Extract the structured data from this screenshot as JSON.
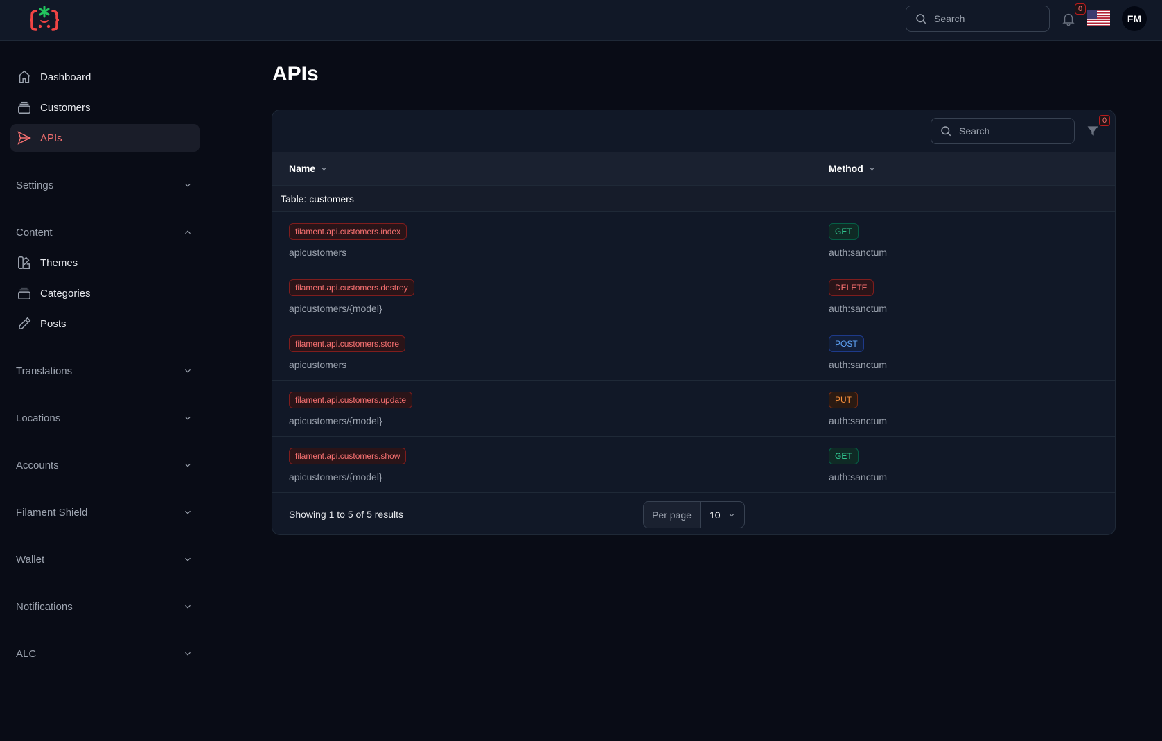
{
  "header": {
    "search_placeholder": "Search",
    "notification_count": "0",
    "avatar_initials": "FM"
  },
  "sidebar": {
    "items": [
      {
        "label": "Dashboard",
        "icon": "home-icon"
      },
      {
        "label": "Customers",
        "icon": "stack-icon"
      },
      {
        "label": "APIs",
        "icon": "paper-plane-icon",
        "active": true
      }
    ],
    "groups": {
      "settings": "Settings",
      "content": "Content",
      "translations": "Translations",
      "locations": "Locations",
      "accounts": "Accounts",
      "filament_shield": "Filament Shield",
      "wallet": "Wallet",
      "notifications": "Notifications",
      "alc": "ALC"
    },
    "content_items": [
      {
        "label": "Themes",
        "icon": "swatch-icon"
      },
      {
        "label": "Categories",
        "icon": "stack-icon"
      },
      {
        "label": "Posts",
        "icon": "pencil-icon"
      }
    ]
  },
  "main": {
    "title": "APIs",
    "table": {
      "search_placeholder": "Search",
      "filter_count": "0",
      "columns": [
        "Name",
        "Method"
      ],
      "group_label": "Table: customers",
      "rows": [
        {
          "name": "filament.api.customers.index",
          "uri": "apicustomers",
          "method": "GET",
          "middleware": "auth:sanctum"
        },
        {
          "name": "filament.api.customers.destroy",
          "uri": "apicustomers/{model}",
          "method": "DELETE",
          "middleware": "auth:sanctum"
        },
        {
          "name": "filament.api.customers.store",
          "uri": "apicustomers",
          "method": "POST",
          "middleware": "auth:sanctum"
        },
        {
          "name": "filament.api.customers.update",
          "uri": "apicustomers/{model}",
          "method": "PUT",
          "middleware": "auth:sanctum"
        },
        {
          "name": "filament.api.customers.show",
          "uri": "apicustomers/{model}",
          "method": "GET",
          "middleware": "auth:sanctum"
        }
      ],
      "summary": "Showing 1 to 5 of 5 results",
      "per_page_label": "Per page",
      "per_page_value": "10"
    }
  },
  "colors": {
    "accent": "#f87171",
    "get": "#34d399",
    "delete": "#f87171",
    "post": "#60a5fa",
    "put": "#fb923c"
  }
}
